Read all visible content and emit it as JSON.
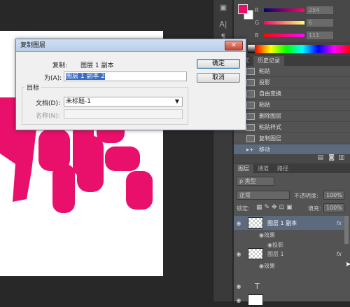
{
  "strip": {
    "icons": [
      "A|",
      "¶",
      "Ａ"
    ]
  },
  "color_panel": {
    "labels": [
      "R",
      "G",
      "B"
    ],
    "values": [
      "254",
      "6",
      "111"
    ],
    "fg_color": "#e6106a",
    "bg_color": "#ffffff"
  },
  "history": {
    "tabs": [
      "样式",
      "历史记录"
    ],
    "items": [
      "粘贴",
      "投影",
      "自由变换",
      "粘贴",
      "删除图层",
      "粘贴样式",
      "复制图层",
      "移动"
    ]
  },
  "layers": {
    "tabs": [
      "图层",
      "通道",
      "路径"
    ],
    "filter_label": "ρ 类型",
    "blend_mode": "正常",
    "opacity_label": "不透明度:",
    "opacity_value": "100%",
    "lock_label": "锁定:",
    "fill_label": "填充:",
    "fill_value": "100%",
    "rows": [
      {
        "name": "图层 1 副本",
        "fx": "fx"
      },
      {
        "name": "效果"
      },
      {
        "name": "投影"
      },
      {
        "name": "图层 1",
        "fx": "fx"
      },
      {
        "name": "效果"
      }
    ]
  },
  "dialog": {
    "title": "复制图层",
    "copy_label": "复制:",
    "copy_value": "图层 1 副本",
    "as_label": "为(A):",
    "as_value": "图层 1 副本 2",
    "target_label": "目标",
    "doc_label": "文档(D):",
    "doc_value": "未标题-1",
    "name_label": "名称(N):",
    "ok": "确定",
    "cancel": "取消",
    "close": "✕"
  }
}
